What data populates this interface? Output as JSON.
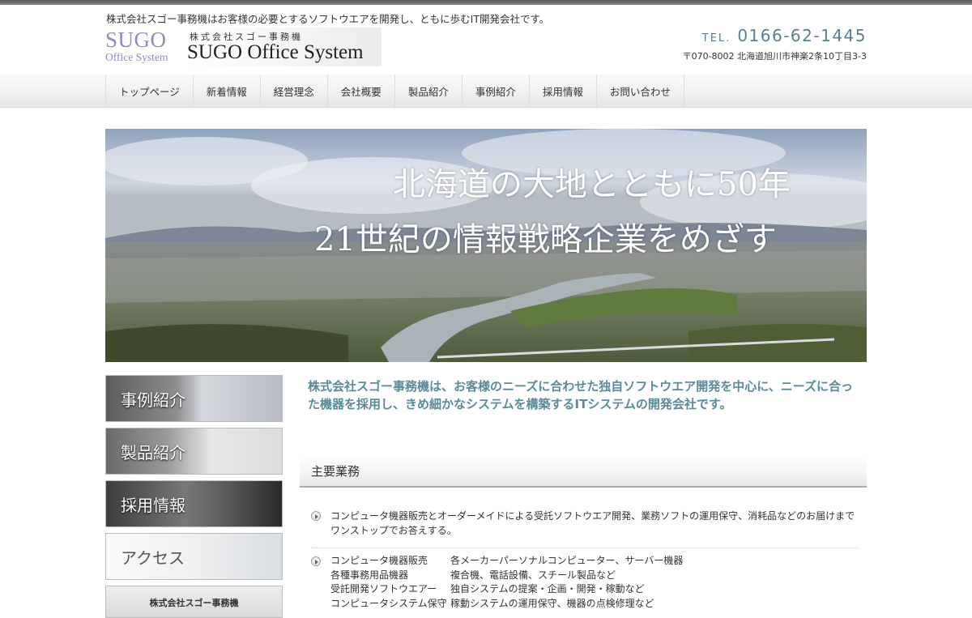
{
  "header": {
    "tagline": "株式会社スゴー事務機はお客様の必要とするソフトウエアを開発し、ともに歩むIT開発会社です。",
    "logo": {
      "sugo": "SUGO",
      "office_system": "Office System",
      "company_jp": "株式会社スゴー事務機",
      "company_en": "SUGO Office System"
    },
    "tel_label": "TEL.",
    "tel_number": "0166-62-1445",
    "address": "〒070-8002 北海道旭川市神楽2条10丁目3-3"
  },
  "nav": {
    "items": [
      {
        "label": "トップページ"
      },
      {
        "label": "新着情報"
      },
      {
        "label": "経営理念"
      },
      {
        "label": "会社概要"
      },
      {
        "label": "製品紹介"
      },
      {
        "label": "事例紹介"
      },
      {
        "label": "採用情報"
      },
      {
        "label": "お問い合わせ"
      }
    ]
  },
  "hero": {
    "line1": "北海道の大地とともに50年",
    "line2": "21世紀の情報戦略企業をめざす"
  },
  "sidebar": {
    "buttons": [
      {
        "label": "事例紹介"
      },
      {
        "label": "製品紹介"
      },
      {
        "label": "採用情報"
      },
      {
        "label": "アクセス"
      }
    ],
    "company_box": "株式会社スゴー事務機"
  },
  "main": {
    "intro": "株式会社スゴー事務機は、お客様のニーズに合わせた独自ソフトウエア開発を中心に、ニーズに合った機器を採用し、きめ細かなシステムを構築するITシステムの開発会社です。",
    "section_title": "主要業務",
    "paragraph": "コンピュータ機器販売とオーダーメイドによる受託ソフトウエア開発、業務ソフトの運用保守、消耗品などのお届けまでワンストップでお答えする。",
    "business": [
      {
        "name": "コンピュータ機器販売",
        "desc": "各メーカーパーソナルコンピューター、サーバー機器"
      },
      {
        "name": "各種事務用品機器",
        "desc": "複合機、電話設備、スチール製品など"
      },
      {
        "name": "受託開発ソフトウエアー",
        "desc": "独自システムの提案・企画・開発・稼動など"
      },
      {
        "name": "コンピュータシステム保守",
        "desc": "稼動システムの運用保守、機器の点検修理など"
      }
    ]
  }
}
